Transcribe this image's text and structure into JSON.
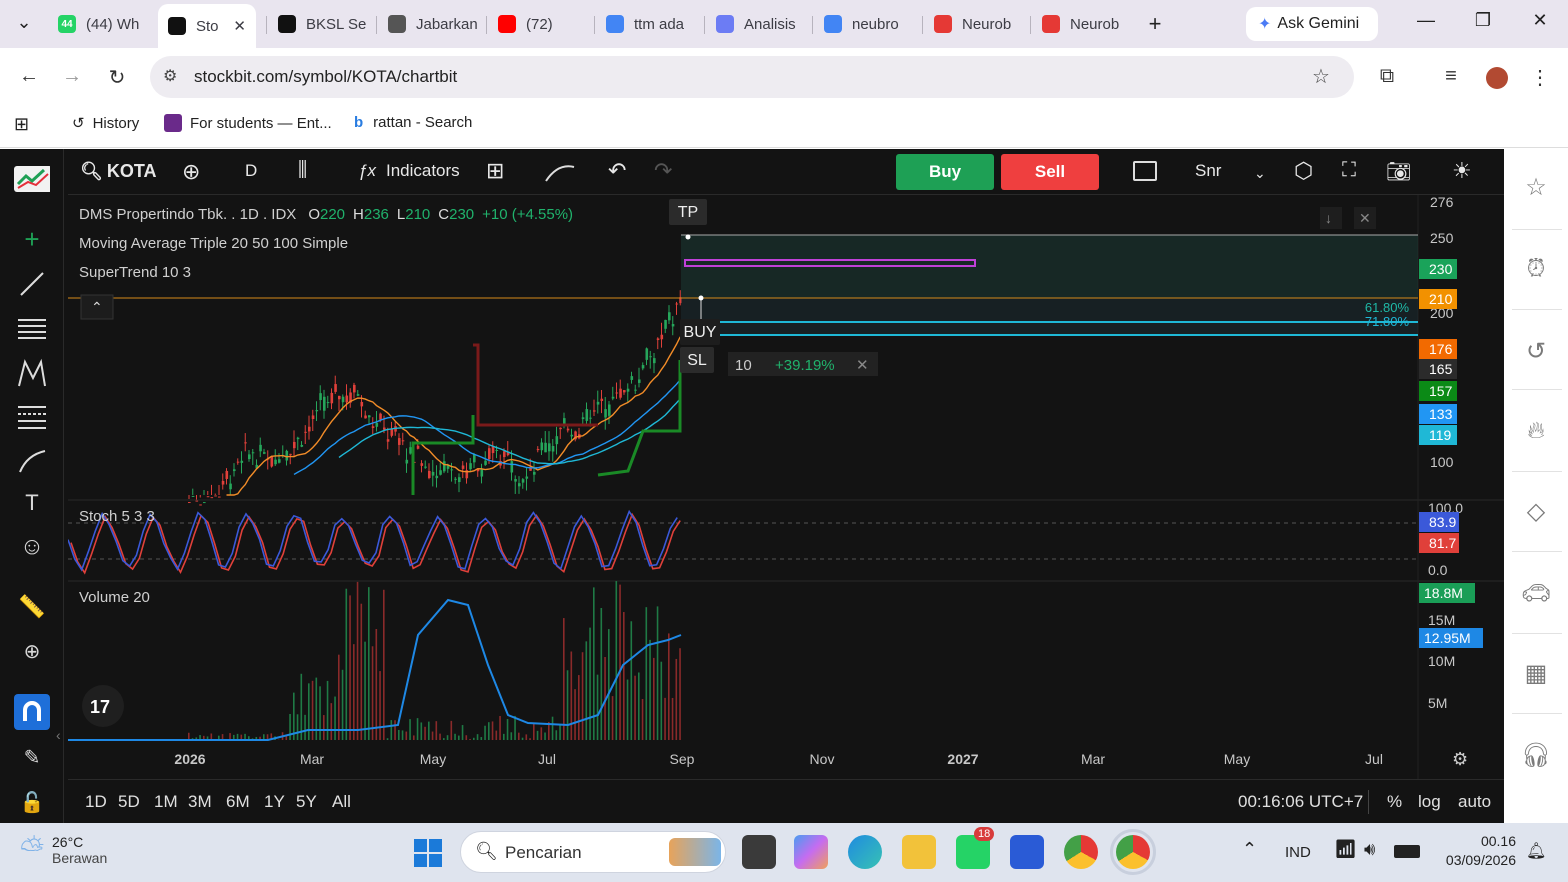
{
  "browser": {
    "tabs": [
      {
        "label": "(44) Wh",
        "color": "#25d366",
        "badge": "44"
      },
      {
        "label": "Sto",
        "color": "#111111",
        "badge": ""
      },
      {
        "label": "BKSL Se",
        "color": "#111111",
        "badge": ""
      },
      {
        "label": "Jabarkan",
        "color": "#555555",
        "badge": ""
      },
      {
        "label": "(72)",
        "color": "#ff0000",
        "badge": ""
      },
      {
        "label": "ttm ada",
        "color": "#4285f4",
        "badge": ""
      },
      {
        "label": "Analisis",
        "color": "#6c7cf4",
        "badge": ""
      },
      {
        "label": "neubro",
        "color": "#4285f4",
        "badge": ""
      },
      {
        "label": "Neurob",
        "color": "#e53935",
        "badge": ""
      },
      {
        "label": "Neurob",
        "color": "#e53935",
        "badge": ""
      }
    ],
    "gemini_label": "Ask Gemini",
    "url": "stockbit.com/symbol/KOTA/chartbit",
    "bookmarks": [
      {
        "label": "History"
      },
      {
        "label": "For students — Ent..."
      },
      {
        "label": "rattan - Search"
      }
    ]
  },
  "toolbar": {
    "symbol": "KOTA",
    "interval": "D",
    "indicators_label": "Indicators",
    "buy_label": "Buy",
    "sell_label": "Sell",
    "layout_label": "Snr"
  },
  "legend": {
    "title": "DMS Propertindo Tbk. . 1D . IDX",
    "open_label": "O",
    "open": "220",
    "high_label": "H",
    "high": "236",
    "low_label": "L",
    "low": "210",
    "close_label": "C",
    "close": "230",
    "change": "+10 (+4.55%)",
    "ma_label": "Moving Average Triple 20 50 100 Simple",
    "st_label": "SuperTrend 10 3",
    "stoch_label": "Stoch 5 3 3",
    "vol_label": "Volume 20"
  },
  "position_tool": {
    "tp_label": "TP",
    "buy_label": "BUY",
    "sl_label": "SL",
    "qty": "10",
    "pnl": "+39.19%",
    "fib1": "61.80%",
    "fib2": "71.80%"
  },
  "price_axis": {
    "ticks": [
      "276",
      "250",
      "200",
      "100"
    ],
    "badges": [
      {
        "label": "230",
        "color": "#1aa35a"
      },
      {
        "label": "210",
        "color": "#f29100"
      },
      {
        "label": "176",
        "color": "#f26a00"
      },
      {
        "label": "165",
        "color": "#2b2b2b"
      },
      {
        "label": "157",
        "color": "#0b8a16"
      },
      {
        "label": "133",
        "color": "#2196f3"
      },
      {
        "label": "119",
        "color": "#1fb8d6"
      }
    ],
    "stoch_ticks": [
      "100.0",
      "0.0"
    ],
    "stoch_badges": [
      {
        "label": "83.9",
        "color": "#3b59d9"
      },
      {
        "label": "81.7",
        "color": "#e0403a"
      }
    ],
    "vol_ticks": [
      "15M",
      "10M",
      "5M"
    ],
    "vol_badges": [
      {
        "label": "18.8M",
        "color": "#1a9e57"
      },
      {
        "label": "12.95M",
        "color": "#1e88e5"
      }
    ]
  },
  "time_axis": [
    "2026",
    "Mar",
    "May",
    "Jul",
    "Sep",
    "Nov",
    "2027",
    "Mar",
    "May",
    "Jul"
  ],
  "bottom": {
    "periods": [
      "1D",
      "5D",
      "1M",
      "3M",
      "6M",
      "1Y",
      "5Y",
      "All"
    ],
    "clock": "00:16:06 UTC+7",
    "pct": "%",
    "log": "log",
    "auto": "auto"
  },
  "taskbar": {
    "weather_temp": "26°C",
    "weather_desc": "Berawan",
    "search_placeholder": "Pencarian",
    "whatsapp_badge": "18",
    "lang": "IND",
    "time": "00.16",
    "date": "03/09/2026"
  },
  "chart_data": {
    "type": "candlestick",
    "last_price": 230,
    "position": {
      "tp": 250,
      "entry": 210,
      "sl": 176
    },
    "stoch": {
      "k": 83.9,
      "d": 81.7,
      "ylim": [
        0,
        100
      ]
    },
    "volume": {
      "last": "18.8M",
      "ma20": "12.95M"
    }
  }
}
